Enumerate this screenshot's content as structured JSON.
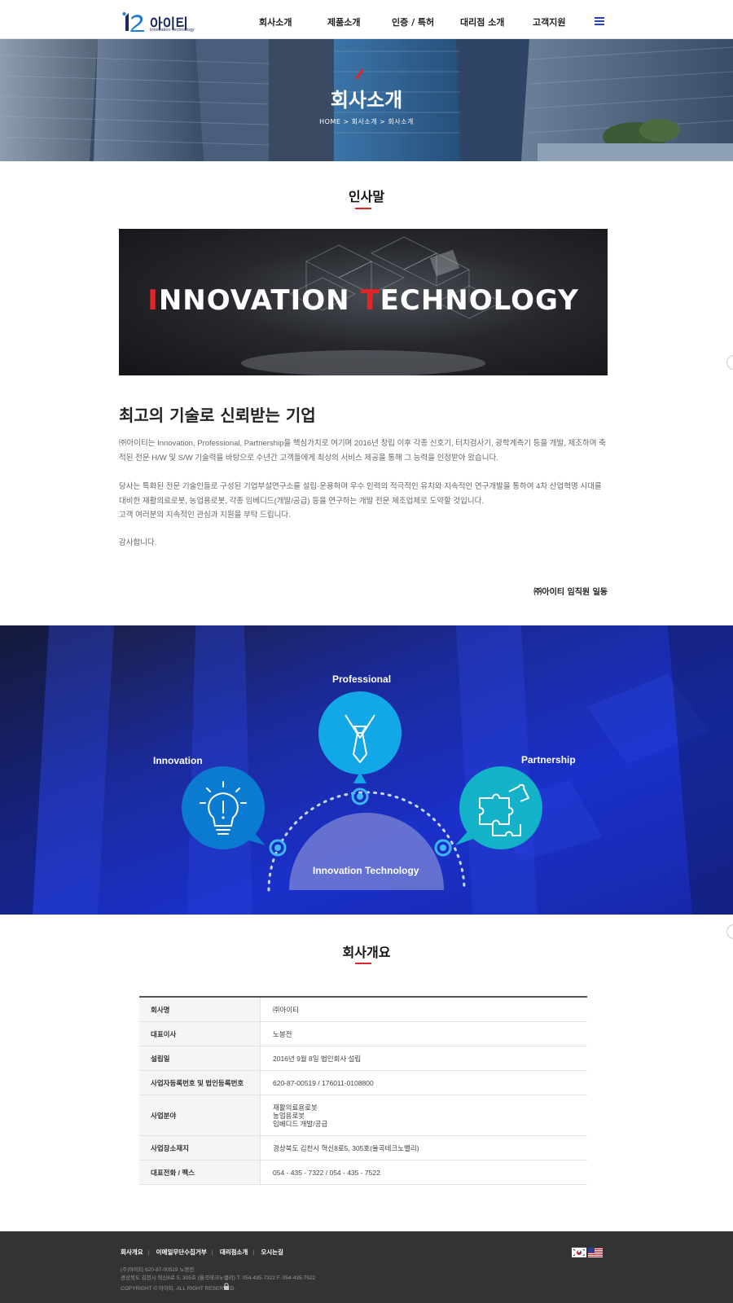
{
  "header": {
    "logo_name": "아이티",
    "logo_sub": "Innovation Technology",
    "nav": [
      "회사소개",
      "제품소개",
      "인증 / 특허",
      "대리점 소개",
      "고객지원"
    ]
  },
  "hero": {
    "title": "회사소개",
    "breadcrumb": "HOME > 회사소개 > 회사소개"
  },
  "greeting": {
    "section_title": "인사말",
    "banner_first_letter": "I",
    "banner_word1_rest": "NNOVATION ",
    "banner_second_letter": "T",
    "banner_word2_rest": "ECHNOLOGY",
    "heading": "최고의 기술로 신뢰받는 기업",
    "p1": "㈜아이티는 Innovation, Professional, Partnership을 핵심가치로 여기며 2016년 창립 이후 각종 신호기, 터치검사기, 광학계측기 등을 개발, 제조하며 축적된 전문 H/W 및 S/W 기술력을 바탕으로 수년간 고객들에게 최상의 서비스 제공을 통해 그 능력을 인정받아 왔습니다.",
    "p2": "당사는 특화된 전문 기술인들로 구성된 기업부설연구소를 설립·운용하며 우수 인력의 적극적인 유치와 지속적인 연구개발을 통하여 4차 산업혁명 시대를 대비한 재활의료로봇, 농업용로봇, 각종 임베디드(개발/공급) 등을 연구하는 개발 전문 제조업체로 도약할 것입니다.",
    "p3": "고객 여러분의 지속적인 관심과 지원을 부탁 드립니다.",
    "p4": "감사합니다.",
    "sign": "㈜아이티 임직원 일동"
  },
  "values": {
    "innovation": "Innovation",
    "professional": "Professional",
    "partnership": "Partnership",
    "center": "Innovation Technology",
    "colors": {
      "innovation": "#0a7bd0",
      "professional": "#12a8e8",
      "partnership": "#14b2c8"
    }
  },
  "overview": {
    "section_title": "회사개요",
    "rows": [
      {
        "label": "회사명",
        "value": [
          "㈜아이티"
        ]
      },
      {
        "label": "대표이사",
        "value": [
          "노봉전"
        ]
      },
      {
        "label": "설립일",
        "value": [
          "2016년 9월 8일 법인회사 설립"
        ]
      },
      {
        "label": "사업자등록번호 및 법인등록번호",
        "value": [
          "620-87-00519 / 176011-0108800"
        ]
      },
      {
        "label": "사업분야",
        "value": [
          "재활의료용로봇",
          "농업용로봇",
          "임베디드 개발/공급"
        ]
      },
      {
        "label": "사업장소재지",
        "value": [
          "경상북도 김천시 혁신8로5, 305호(율곡테크노밸리)"
        ]
      },
      {
        "label": "대표전화 / 팩스",
        "value": [
          "054 - 435 - 7322 / 054 - 435 - 7522"
        ]
      }
    ]
  },
  "footer": {
    "links": [
      "회사개요",
      "이메일무단수집거부",
      "대리점소개",
      "오시는길"
    ],
    "line1": "(주)아이티    620-87-00519    노봉전",
    "line2": "경상북도 김천시 혁신8로 5, 305호 (율곡테크노밸리)    T. 054-435-7322    F. 054-435-7522",
    "copyright": "COPYRIGHT © 아이티. ALL RIGHT RESERVED."
  },
  "accent_color": "#e0262b",
  "brand_color": "#1e2a5e"
}
